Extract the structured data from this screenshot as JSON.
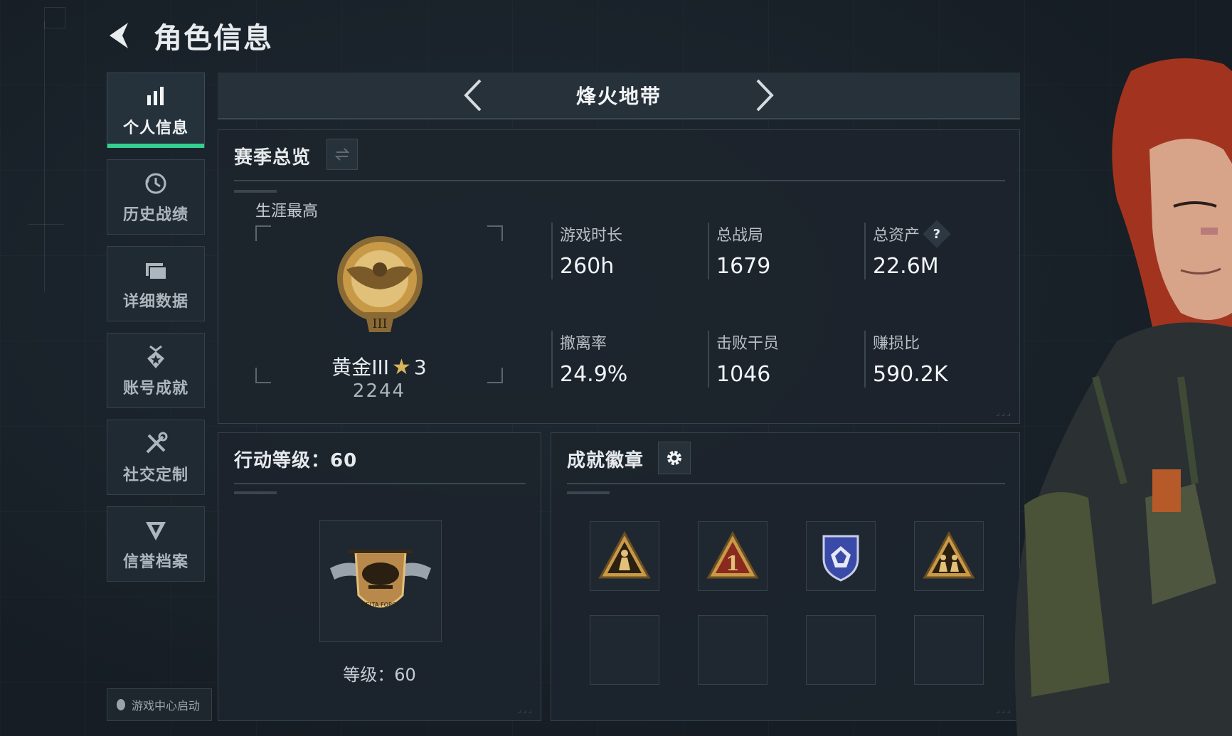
{
  "header": {
    "title": "角色信息"
  },
  "sidebar": {
    "items": [
      {
        "label": "个人信息",
        "icon": "bar-chart-icon",
        "active": true
      },
      {
        "label": "历史战绩",
        "icon": "history-clock-icon",
        "active": false
      },
      {
        "label": "详细数据",
        "icon": "folder-icon",
        "active": false
      },
      {
        "label": "账号成就",
        "icon": "achievement-medal-icon",
        "active": false
      },
      {
        "label": "社交定制",
        "icon": "tools-icon",
        "active": false
      },
      {
        "label": "信誉档案",
        "icon": "reputation-shield-icon",
        "active": false
      }
    ],
    "footer_label": "游戏中心启动"
  },
  "mode": {
    "title": "烽火地带"
  },
  "season": {
    "title": "赛季总览",
    "career_label": "生涯最高",
    "rank": {
      "name": "黄金III",
      "stars": "3",
      "score": "2244"
    },
    "stats": [
      {
        "label": "游戏时长",
        "value": "260h"
      },
      {
        "label": "总战局",
        "value": "1679"
      },
      {
        "label": "总资产",
        "value": "22.6M",
        "help": "?"
      },
      {
        "label": "撤离率",
        "value": "24.9%"
      },
      {
        "label": "击败干员",
        "value": "1046"
      },
      {
        "label": "赚损比",
        "value": "590.2K"
      }
    ]
  },
  "level": {
    "title": "行动等级：60",
    "level_text": "等级：60",
    "badge_inscription": "DELTA FORCE"
  },
  "badges": {
    "title": "成就徽章",
    "slots": [
      {
        "icon": "soldier-triangle-badge-icon",
        "filled": true
      },
      {
        "icon": "number-one-triangle-badge-icon",
        "filled": true
      },
      {
        "icon": "blue-shield-badge-icon",
        "filled": true
      },
      {
        "icon": "squad-triangle-badge-icon",
        "filled": true
      },
      {
        "filled": false
      },
      {
        "filled": false
      },
      {
        "filled": false
      },
      {
        "filled": false
      }
    ]
  },
  "colors": {
    "accent_green": "#33d08f",
    "gold": "#c89a48",
    "background": "#1a222b"
  }
}
